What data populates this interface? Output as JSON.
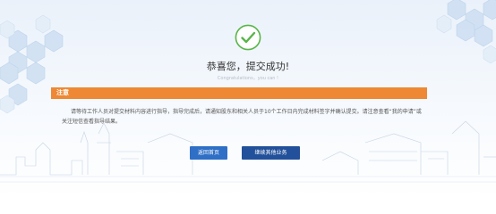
{
  "result": {
    "icon": "check-circle-icon",
    "title": "恭喜您，提交成功!",
    "subtitle": "Congratulations，you can !"
  },
  "notice": {
    "label": "注意",
    "text": "请等待工作人员对提交材料内容进行指导，指导完成后，请通知股东和相关人员于10个工作日内完成材料签字并确认提交。请注意查看“我的申请”或关注短信查看指导结果。"
  },
  "buttons": {
    "home_label": "返回首页",
    "continue_label": "继续其他业务"
  },
  "colors": {
    "accent_green": "#58b548",
    "notice_orange": "#ee8834",
    "button_blue": "#2f6fc6",
    "button_dark_blue": "#22509a"
  }
}
